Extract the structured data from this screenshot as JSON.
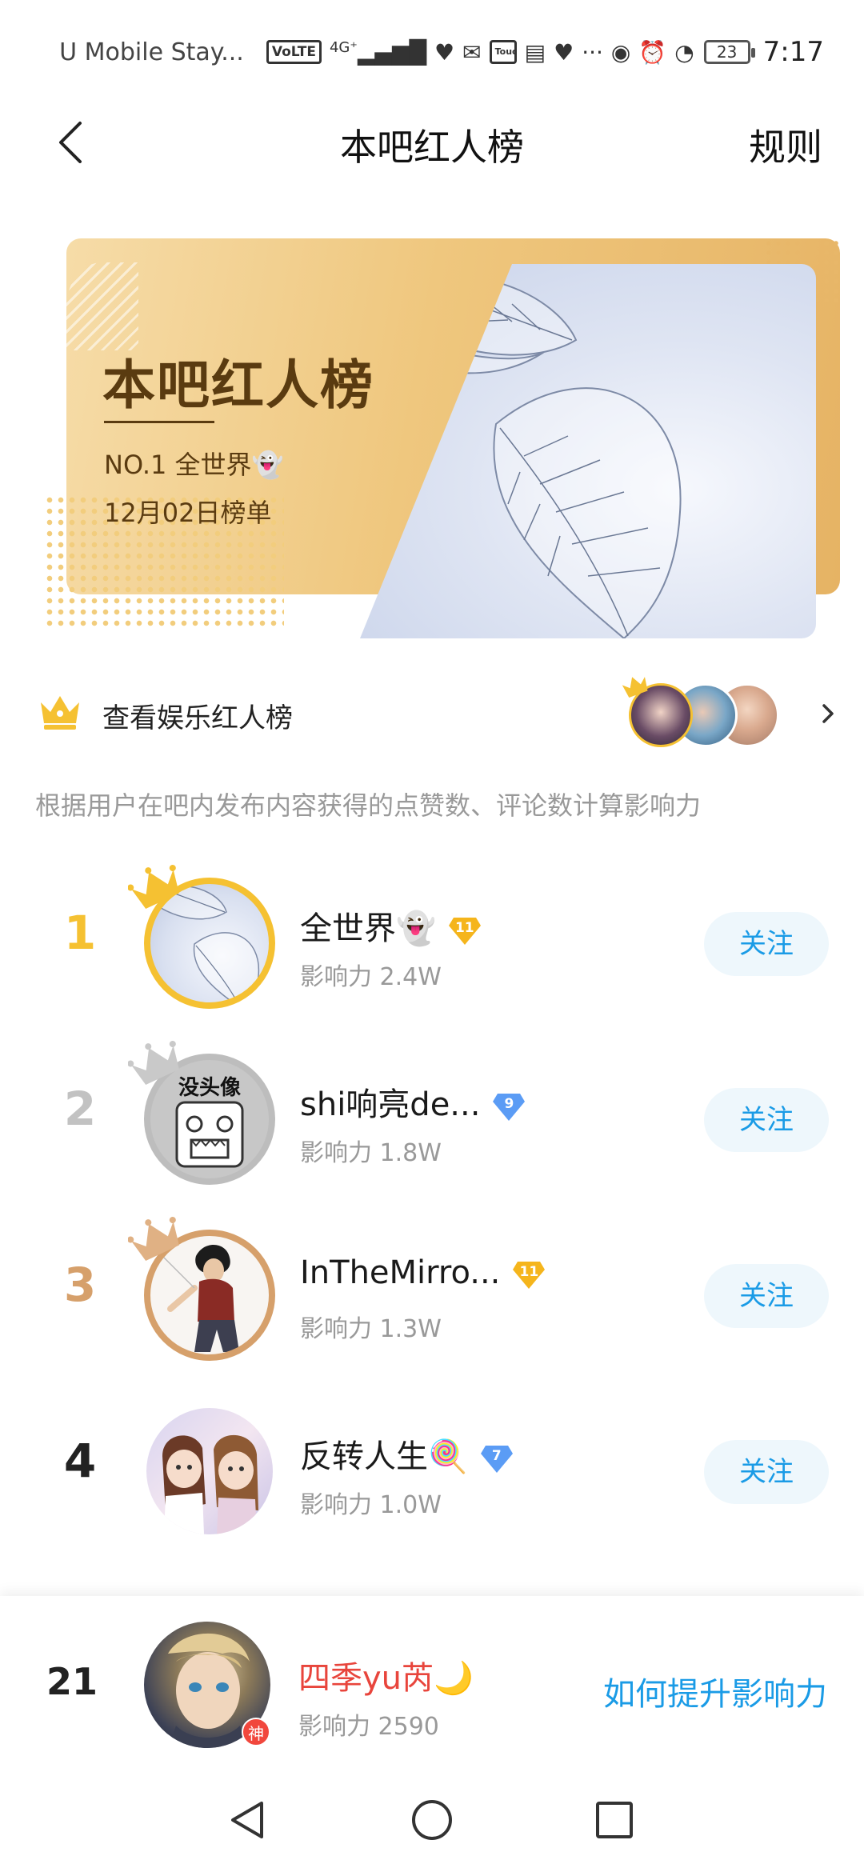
{
  "status_bar": {
    "carrier": "U Mobile Stay...",
    "volte": "VoLTE",
    "network": "4G⁺",
    "touch_ngo": "Touch'nGo",
    "more": "···",
    "battery": "23",
    "time": "7:17"
  },
  "header": {
    "title": "本吧红人榜",
    "rules_label": "规则"
  },
  "banner": {
    "title": "本吧红人榜",
    "no1_label": "NO.1  全世界👻",
    "date_label": "12月02日榜单"
  },
  "entertainment": {
    "label": "查看娱乐红人榜"
  },
  "description": "根据用户在吧内发布内容获得的点赞数、评论数计算影响力",
  "ranking": [
    {
      "rank": "1",
      "name": "全世界👻",
      "level": "11",
      "influence": "影响力  2.4W",
      "follow": "关注",
      "rank_color": "#f5c132",
      "level_type": "gold"
    },
    {
      "rank": "2",
      "name": "shi响亮de...",
      "level": "9",
      "influence": "影响力  1.8W",
      "follow": "关注",
      "rank_color": "#c2c2c2",
      "level_type": "blue"
    },
    {
      "rank": "3",
      "name": "InTheMirro...",
      "level": "11",
      "influence": "影响力  1.3W",
      "follow": "关注",
      "rank_color": "#d6a06b",
      "level_type": "gold"
    },
    {
      "rank": "4",
      "name": "反转人生🍭",
      "level": "7",
      "influence": "影响力  1.0W",
      "follow": "关注",
      "rank_color": "#222222",
      "level_type": "blue"
    }
  ],
  "my_rank": {
    "rank": "21",
    "name": "四季yu芮🌙",
    "influence": "影响力  2590",
    "badge": "神",
    "how_label": "如何提升影响力"
  },
  "colors": {
    "accent_blue": "#1a9be6",
    "gold": "#f5c132",
    "my_name_red": "#e8453c"
  }
}
